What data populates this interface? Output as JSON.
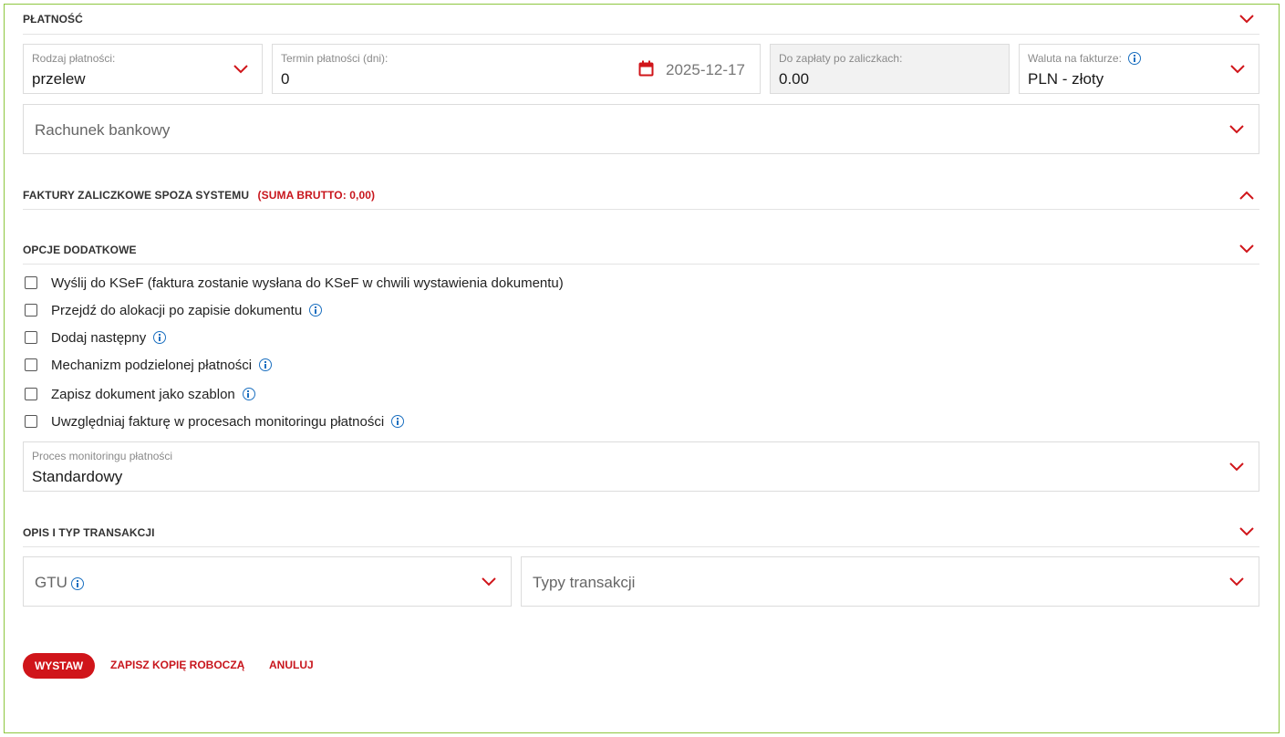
{
  "sections": {
    "payment": "PŁATNOŚĆ",
    "advance_invoices": "FAKTURY ZALICZKOWE SPOZA SYSTEMU",
    "advance_sum": "(SUMA BRUTTO: 0,00)",
    "options": "OPCJE DODATKOWE",
    "transaction": "OPIS I TYP TRANSAKCJI"
  },
  "payment": {
    "type_label": "Rodzaj płatności:",
    "type_value": "przelew",
    "term_label": "Termin płatności (dni):",
    "term_value": "0",
    "due_date": "2025-12-17",
    "to_pay_label": "Do zapłaty po zaliczkach:",
    "to_pay_value": "0.00",
    "currency_label": "Waluta na fakturze:",
    "currency_value": "PLN - złoty",
    "bank_account_placeholder": "Rachunek bankowy"
  },
  "options": {
    "checkboxes": [
      {
        "label": "Wyślij do KSeF (faktura zostanie wysłana do KSeF w chwili wystawienia dokumentu)",
        "checked": false,
        "info": false
      },
      {
        "label": "Przejdź do alokacji po zapisie dokumentu",
        "checked": false,
        "info": true
      },
      {
        "label": "Dodaj następny",
        "checked": false,
        "info": true
      },
      {
        "label": "Mechanizm podzielonej płatności",
        "checked": false,
        "info": true
      },
      {
        "label": "Zapisz dokument jako szablon",
        "checked": false,
        "info": true
      },
      {
        "label": "Uwzględniaj fakturę w procesach monitoringu płatności",
        "checked": false,
        "info": true
      }
    ],
    "monitoring_label": "Proces monitoringu płatności",
    "monitoring_value": "Standardowy"
  },
  "transaction": {
    "gtu_placeholder": "GTU",
    "types_placeholder": "Typy transakcji"
  },
  "actions": {
    "issue": "WYSTAW",
    "save_draft": "ZAPISZ KOPIĘ ROBOCZĄ",
    "cancel": "ANULUJ"
  },
  "colors": {
    "accent_red": "#d0151a",
    "info_blue": "#1a6fc0",
    "frame_green": "#8dc63f"
  },
  "icons": {
    "expand": "chevron-down-icon",
    "collapse": "chevron-up-icon",
    "calendar": "calendar-icon",
    "info": "info-icon"
  }
}
